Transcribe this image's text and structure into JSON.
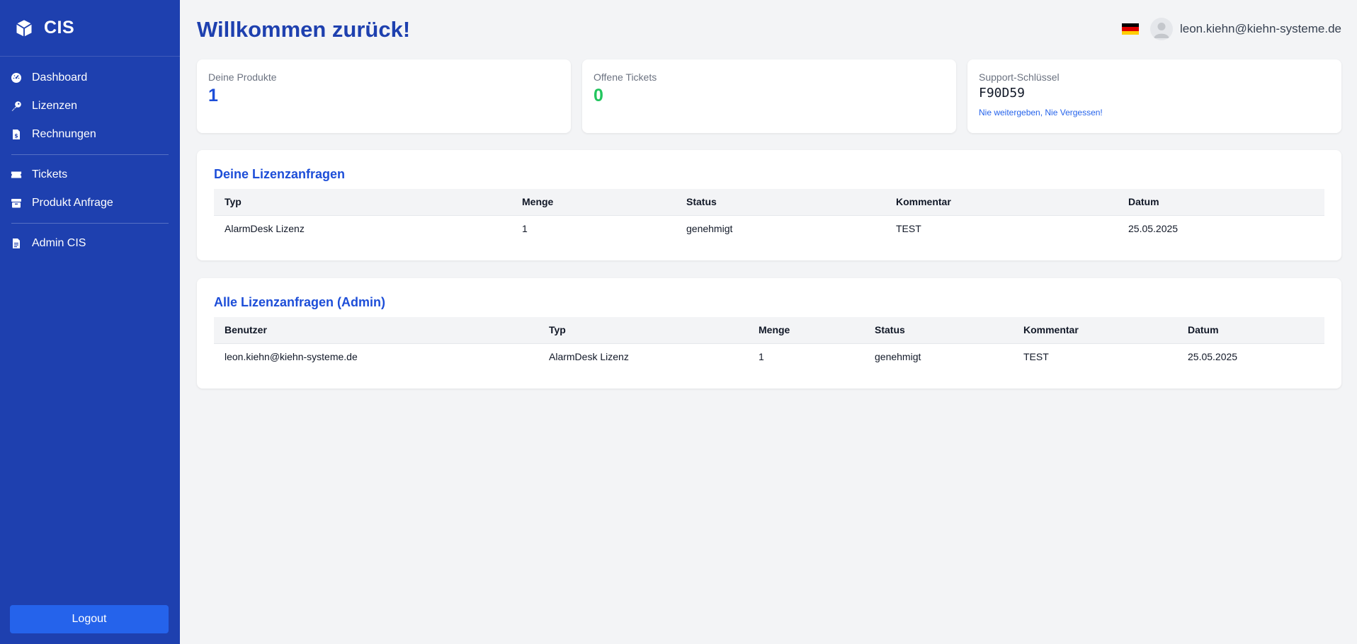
{
  "brand": {
    "name": "CIS",
    "icon": "cube-icon"
  },
  "sidebar": {
    "items": [
      {
        "label": "Dashboard",
        "icon": "dashboard-gauge-icon"
      },
      {
        "label": "Lizenzen",
        "icon": "key-icon"
      },
      {
        "label": "Rechnungen",
        "icon": "invoice-icon"
      },
      {
        "label": "Tickets",
        "icon": "ticket-icon"
      },
      {
        "label": "Produkt Anfrage",
        "icon": "box-icon"
      },
      {
        "label": "Admin CIS",
        "icon": "document-icon"
      }
    ],
    "logout_label": "Logout"
  },
  "header": {
    "title": "Willkommen zurück!",
    "user_email": "leon.kiehn@kiehn-systeme.de",
    "language_flag": "german-flag-icon"
  },
  "stats": {
    "products": {
      "label": "Deine Produkte",
      "value": "1",
      "color": "#1d4ed8"
    },
    "tickets": {
      "label": "Offene Tickets",
      "value": "0",
      "color": "#22c55e"
    },
    "support": {
      "label": "Support-Schlüssel",
      "value": "F90D59",
      "note": "Nie weitergeben, Nie Vergessen!"
    }
  },
  "my_requests": {
    "title": "Deine Lizenzanfragen",
    "columns": [
      "Typ",
      "Menge",
      "Status",
      "Kommentar",
      "Datum"
    ],
    "rows": [
      [
        "AlarmDesk Lizenz",
        "1",
        "genehmigt",
        "TEST",
        "25.05.2025"
      ]
    ]
  },
  "all_requests": {
    "title": "Alle Lizenzanfragen (Admin)",
    "columns": [
      "Benutzer",
      "Typ",
      "Menge",
      "Status",
      "Kommentar",
      "Datum"
    ],
    "rows": [
      [
        "leon.kiehn@kiehn-systeme.de",
        "AlarmDesk Lizenz",
        "1",
        "genehmigt",
        "TEST",
        "25.05.2025"
      ]
    ]
  },
  "colors": {
    "sidebar": "#1e40af",
    "accent": "#2563eb",
    "background": "#f3f4f6"
  }
}
